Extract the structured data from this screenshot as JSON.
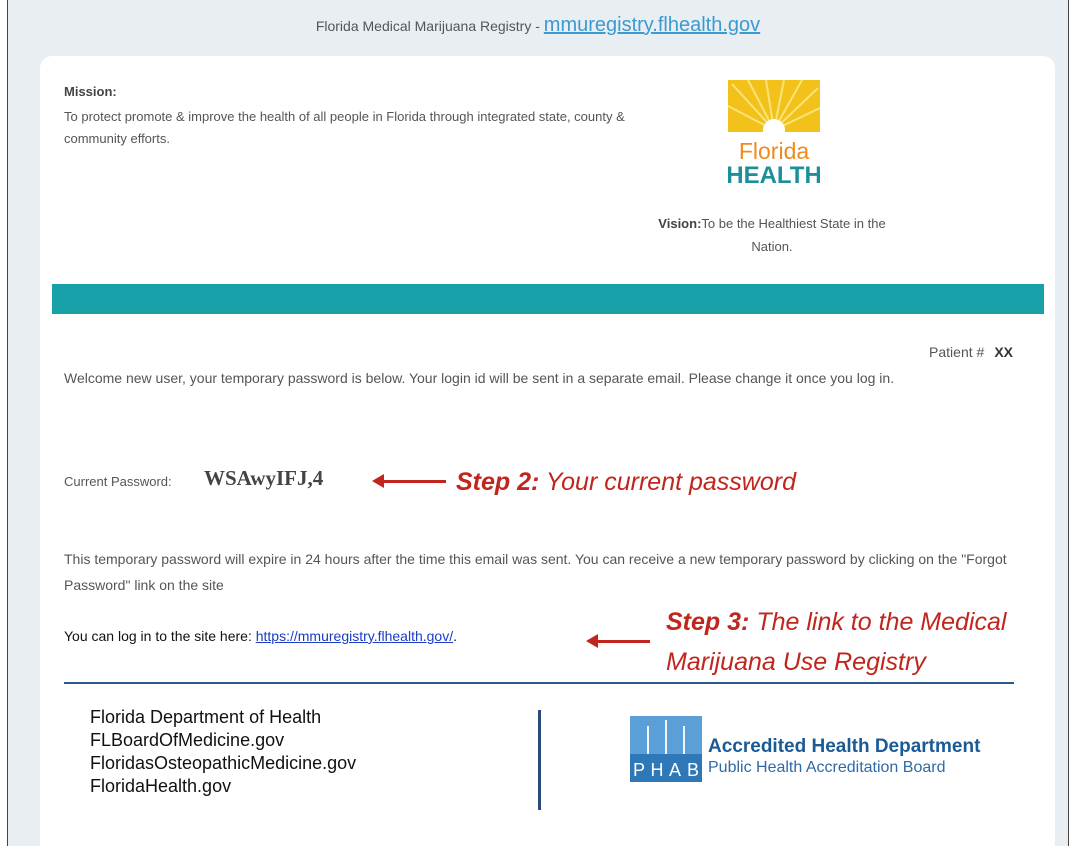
{
  "header": {
    "prefix": "Florida Medical Marijuana Registry -",
    "link_text": "mmuregistry.flhealth.gov"
  },
  "mission": {
    "title": "Mission:",
    "text": "To protect promote & improve the health of all people in Florida through integrated state, county & community efforts."
  },
  "logo": {
    "line1": "Florida",
    "line2": "HEALTH"
  },
  "vision": {
    "label": "Vision:",
    "text": "To be the Healthiest State in the Nation."
  },
  "patient": {
    "label": "Patient #",
    "value": "XX"
  },
  "welcome_text": "Welcome new user, your temporary password is below. Your login id will be sent in a separate email. Please change it once you log in.",
  "password": {
    "label": "Current Password:",
    "value": "WSAwyIFJ,4"
  },
  "annotations": {
    "step2_bold": "Step 2:",
    "step2_text": "Your current password",
    "step3_bold": "Step 3:",
    "step3_text": "The link to the Medical",
    "step3_text2": "Marijuana Use Registry"
  },
  "expire_text": "This temporary password will expire in 24 hours after the time this email was sent. You can receive a new temporary password by clicking on the \"Forgot Password\" link on the site",
  "login": {
    "prefix": "You can log in to the site here:",
    "link": "https://mmuregistry.flhealth.gov/",
    "suffix": "."
  },
  "footer": {
    "links": [
      "Florida Department of Health",
      "FLBoardOfMedicine.gov",
      "FloridasOsteopathicMedicine.gov",
      "FloridaHealth.gov"
    ],
    "phab_letters": [
      "P",
      "H",
      "A",
      "B"
    ],
    "phab_title": "Accredited Health Department",
    "phab_subtitle": "Public Health Accreditation Board"
  },
  "colors": {
    "teal_bar": "#17a0a8",
    "annotation_red": "#c0261d",
    "link_blue": "#1a3cc8",
    "phab_blue": "#1a5a96"
  }
}
